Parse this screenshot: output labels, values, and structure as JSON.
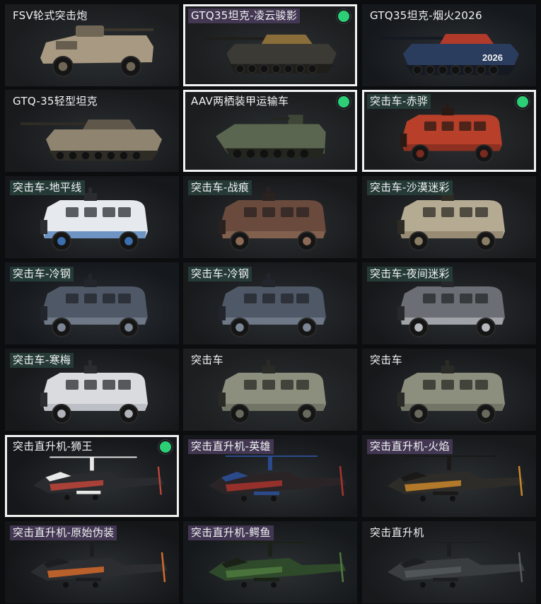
{
  "items": [
    {
      "label": "FSV轮式突击炮",
      "kind": "fsv",
      "tag": "none",
      "selected": false,
      "owned": false,
      "colors": [
        "#a89a82",
        "#6f6656",
        "#3a352d"
      ],
      "bg": "#1a1c1e"
    },
    {
      "label": "GTQ35坦克-凌云骏影",
      "kind": "tank",
      "tag": "purple",
      "selected": true,
      "owned": true,
      "colors": [
        "#3b3a35",
        "#8a6e3a",
        "#1f1e1b"
      ],
      "bg": "#1b1d1e"
    },
    {
      "label": "GTQ35坦克-烟火2026",
      "kind": "tank",
      "tag": "none",
      "selected": false,
      "owned": false,
      "colors": [
        "#2b3d5e",
        "#b23a2b",
        "#151a22"
      ],
      "bg": "#15181c",
      "decal": "2026"
    },
    {
      "label": "GTQ-35轻型坦克",
      "kind": "tank",
      "tag": "none",
      "selected": false,
      "owned": false,
      "colors": [
        "#8f8470",
        "#5f574a",
        "#2f2b25"
      ],
      "bg": "#181a1c"
    },
    {
      "label": "AAV两栖装甲运输车",
      "kind": "aav",
      "tag": "none",
      "selected": true,
      "owned": true,
      "colors": [
        "#5b6650",
        "#3e4637",
        "#22261e"
      ],
      "bg": "#1b1d1e"
    },
    {
      "label": "突击车-赤骅",
      "kind": "truck",
      "tag": "green",
      "selected": true,
      "owned": true,
      "colors": [
        "#b8402a",
        "#7a2a1e",
        "#2a1a16"
      ],
      "bg": "#1a1b1c"
    },
    {
      "label": "突击车-地平线",
      "kind": "truck",
      "tag": "green",
      "selected": false,
      "owned": false,
      "colors": [
        "#e6e9ee",
        "#3b6fb0",
        "#2a2c30"
      ],
      "bg": "#15171a"
    },
    {
      "label": "突击车-战痕",
      "kind": "truck",
      "tag": "green",
      "selected": false,
      "owned": false,
      "colors": [
        "#6a4a3c",
        "#8c6a55",
        "#2a2220"
      ],
      "bg": "#18191b"
    },
    {
      "label": "突击车-沙漠迷彩",
      "kind": "truck",
      "tag": "green",
      "selected": false,
      "owned": false,
      "colors": [
        "#b5ab93",
        "#8a7e66",
        "#2e2b25"
      ],
      "bg": "#18191b"
    },
    {
      "label": "突击车-冷钢",
      "kind": "truck",
      "tag": "green",
      "selected": false,
      "owned": false,
      "colors": [
        "#4f5866",
        "#7c8694",
        "#22262c"
      ],
      "bg": "#15191e"
    },
    {
      "label": "突击车-冷钢",
      "kind": "truck",
      "tag": "green",
      "selected": false,
      "owned": false,
      "colors": [
        "#4f5866",
        "#7c8694",
        "#22262c"
      ],
      "bg": "#181a1c"
    },
    {
      "label": "突击车-夜间迷彩",
      "kind": "truck",
      "tag": "green",
      "selected": false,
      "owned": false,
      "colors": [
        "#6b6f75",
        "#b6b9bd",
        "#26282b"
      ],
      "bg": "#16181a"
    },
    {
      "label": "突击车-寒梅",
      "kind": "truck",
      "tag": "green",
      "selected": false,
      "owned": false,
      "colors": [
        "#d9dbdf",
        "#b0b4ba",
        "#2a2c30"
      ],
      "bg": "#16181a"
    },
    {
      "label": "突击车",
      "kind": "truck",
      "tag": "none",
      "selected": false,
      "owned": false,
      "colors": [
        "#8c8f7e",
        "#676a5c",
        "#2a2b26"
      ],
      "bg": "#1c1e1f"
    },
    {
      "label": "突击车",
      "kind": "truck",
      "tag": "none",
      "selected": false,
      "owned": false,
      "colors": [
        "#8c8f7e",
        "#676a5c",
        "#2a2b26"
      ],
      "bg": "#16181a"
    },
    {
      "label": "突击直升机-狮王",
      "kind": "heli",
      "tag": "none",
      "selected": true,
      "owned": true,
      "colors": [
        "#2a2b2e",
        "#c0453a",
        "#e8e8e8"
      ],
      "bg": "#15171a"
    },
    {
      "label": "突击直升机-英雄",
      "kind": "heli",
      "tag": "purple",
      "selected": false,
      "owned": false,
      "colors": [
        "#2a2426",
        "#a8342c",
        "#2b4a8c"
      ],
      "bg": "#15171a"
    },
    {
      "label": "突击直升机-火焰",
      "kind": "heli",
      "tag": "purple",
      "selected": false,
      "owned": false,
      "colors": [
        "#2e2c28",
        "#c9872a",
        "#1a1918"
      ],
      "bg": "#17191b"
    },
    {
      "label": "突击直升机-原始伪装",
      "kind": "heli",
      "tag": "purple",
      "selected": false,
      "owned": false,
      "colors": [
        "#2c2d30",
        "#d46a2a",
        "#1c1d1f"
      ],
      "bg": "#141618"
    },
    {
      "label": "突击直升机-鳄鱼",
      "kind": "heli",
      "tag": "purple",
      "selected": false,
      "owned": false,
      "colors": [
        "#2f4a2a",
        "#4f7a3f",
        "#1a2218"
      ],
      "bg": "#16191c"
    },
    {
      "label": "突击直升机",
      "kind": "heli",
      "tag": "none",
      "selected": false,
      "owned": false,
      "colors": [
        "#3a3d40",
        "#55595d",
        "#1c1e20"
      ],
      "bg": "#17191b"
    }
  ]
}
